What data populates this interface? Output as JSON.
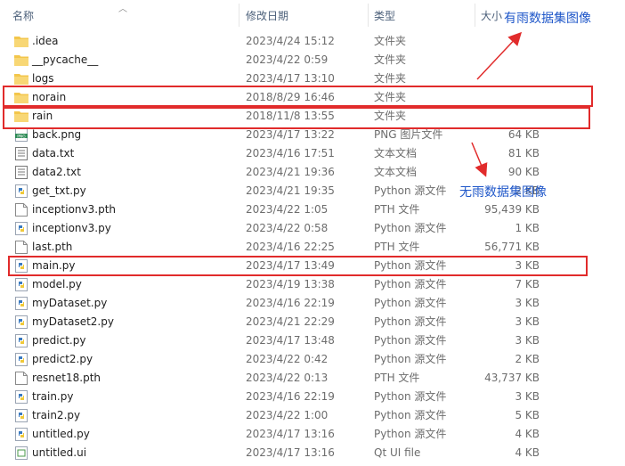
{
  "header": {
    "col_name": "名称",
    "col_date": "修改日期",
    "col_type": "类型",
    "col_size": "大小"
  },
  "annotations": {
    "rain_label": "有雨数据集图像",
    "norain_label": "无雨数据集图像"
  },
  "files": [
    {
      "name": ".idea",
      "date": "2023/4/24 15:12",
      "type": "文件夹",
      "size": "",
      "icon": "folder-icon"
    },
    {
      "name": "__pycache__",
      "date": "2023/4/22 0:59",
      "type": "文件夹",
      "size": "",
      "icon": "folder-icon"
    },
    {
      "name": "logs",
      "date": "2023/4/17 13:10",
      "type": "文件夹",
      "size": "",
      "icon": "folder-icon"
    },
    {
      "name": "norain",
      "date": "2018/8/29 16:46",
      "type": "文件夹",
      "size": "",
      "icon": "folder-icon"
    },
    {
      "name": "rain",
      "date": "2018/11/8 13:55",
      "type": "文件夹",
      "size": "",
      "icon": "folder-icon"
    },
    {
      "name": "back.png",
      "date": "2023/4/17 13:22",
      "type": "PNG 图片文件",
      "size": "64 KB",
      "icon": "png-file-icon"
    },
    {
      "name": "data.txt",
      "date": "2023/4/16 17:51",
      "type": "文本文档",
      "size": "81 KB",
      "icon": "text-file-icon"
    },
    {
      "name": "data2.txt",
      "date": "2023/4/21 19:36",
      "type": "文本文档",
      "size": "90 KB",
      "icon": "text-file-icon"
    },
    {
      "name": "get_txt.py",
      "date": "2023/4/21 19:35",
      "type": "Python 源文件",
      "size": "2 KB",
      "icon": "python-file-icon"
    },
    {
      "name": "inceptionv3.pth",
      "date": "2023/4/22 1:05",
      "type": "PTH 文件",
      "size": "95,439 KB",
      "icon": "blank-file-icon"
    },
    {
      "name": "inceptionv3.py",
      "date": "2023/4/22 0:58",
      "type": "Python 源文件",
      "size": "1 KB",
      "icon": "python-file-icon"
    },
    {
      "name": "last.pth",
      "date": "2023/4/16 22:25",
      "type": "PTH 文件",
      "size": "56,771 KB",
      "icon": "blank-file-icon"
    },
    {
      "name": "main.py",
      "date": "2023/4/17 13:49",
      "type": "Python 源文件",
      "size": "3 KB",
      "icon": "python-file-icon"
    },
    {
      "name": "model.py",
      "date": "2023/4/19 13:38",
      "type": "Python 源文件",
      "size": "7 KB",
      "icon": "python-file-icon"
    },
    {
      "name": "myDataset.py",
      "date": "2023/4/16 22:19",
      "type": "Python 源文件",
      "size": "3 KB",
      "icon": "python-file-icon"
    },
    {
      "name": "myDataset2.py",
      "date": "2023/4/21 22:29",
      "type": "Python 源文件",
      "size": "3 KB",
      "icon": "python-file-icon"
    },
    {
      "name": "predict.py",
      "date": "2023/4/17 13:48",
      "type": "Python 源文件",
      "size": "3 KB",
      "icon": "python-file-icon"
    },
    {
      "name": "predict2.py",
      "date": "2023/4/22 0:42",
      "type": "Python 源文件",
      "size": "2 KB",
      "icon": "python-file-icon"
    },
    {
      "name": "resnet18.pth",
      "date": "2023/4/22 0:13",
      "type": "PTH 文件",
      "size": "43,737 KB",
      "icon": "blank-file-icon"
    },
    {
      "name": "train.py",
      "date": "2023/4/16 22:19",
      "type": "Python 源文件",
      "size": "3 KB",
      "icon": "python-file-icon"
    },
    {
      "name": "train2.py",
      "date": "2023/4/22 1:00",
      "type": "Python 源文件",
      "size": "5 KB",
      "icon": "python-file-icon"
    },
    {
      "name": "untitled.py",
      "date": "2023/4/17 13:16",
      "type": "Python 源文件",
      "size": "4 KB",
      "icon": "python-file-icon"
    },
    {
      "name": "untitled.ui",
      "date": "2023/4/17 13:16",
      "type": "Qt UI file",
      "size": "4 KB",
      "icon": "ui-file-icon"
    }
  ],
  "colors": {
    "highlight_box": "#e12b2b",
    "annotation_text": "#1f57c9",
    "folder": "#f3c64b",
    "python_icon": "#3a7ac0"
  }
}
